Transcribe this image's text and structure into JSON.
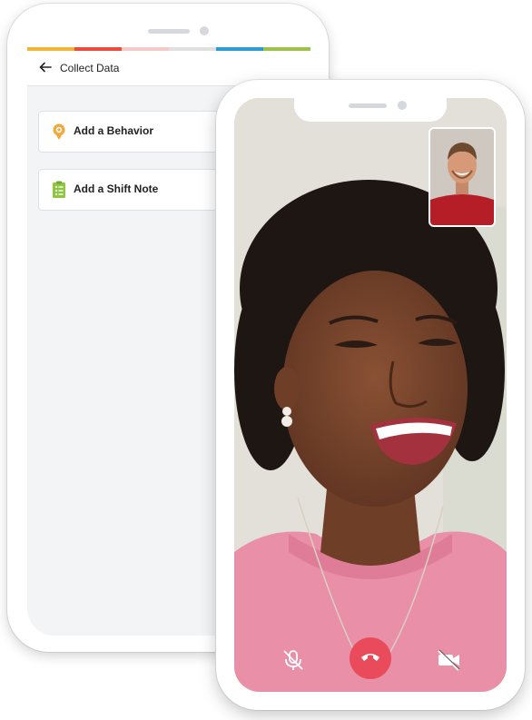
{
  "stripe_colors": [
    "#f5b335",
    "#ed4a3a",
    "#d8d8d8",
    "#2a9bd6",
    "#9bc34a"
  ],
  "collect": {
    "title": "Collect Data",
    "back_icon": "arrow-left-icon",
    "items": [
      {
        "label": "Add a Behavior",
        "icon": "behavior-icon",
        "color": "#f2a93b"
      },
      {
        "label": "Add a Shift Note",
        "icon": "clipboard-list-icon",
        "color": "#8dc63f"
      }
    ]
  },
  "call": {
    "mute_icon": "mic-off-icon",
    "end_icon": "phone-hangup-icon",
    "video_icon": "video-off-icon",
    "end_color": "#e94b5a"
  }
}
